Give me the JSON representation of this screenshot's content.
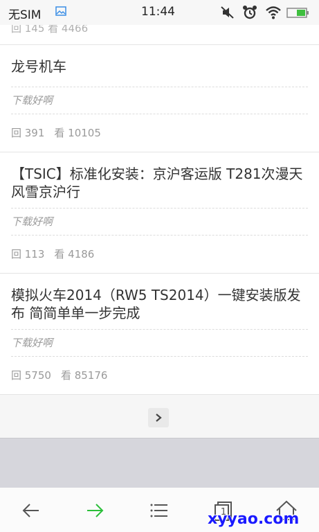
{
  "status_bar": {
    "carrier": "无SIM",
    "time": "11:44",
    "icons": [
      "image-icon",
      "mute-icon",
      "alarm-icon",
      "wifi-icon",
      "battery-icon"
    ]
  },
  "previous_item_meta": "回 145  看 4466",
  "items": [
    {
      "title": "龙号机车",
      "quote": "下载好啊",
      "replies": "回 391",
      "views": "看 10105"
    },
    {
      "title": "【TSIC】标准化安装：京沪客运版 T281次漫天风雪京沪行",
      "quote": "下载好啊",
      "replies": "回 113",
      "views": "看 4186"
    },
    {
      "title": "模拟火车2014（RW5 TS2014）一键安装版发布 简简单单一步完成",
      "quote": "下载好啊",
      "replies": "回 5750",
      "views": "看 85176"
    }
  ],
  "pager": {
    "next_icon": "chevron-right-icon"
  },
  "nav_bar": {
    "icons": [
      "back-arrow-icon",
      "forward-arrow-icon",
      "menu-icon",
      "tabs-icon",
      "home-icon"
    ],
    "tabs_count": "1",
    "forward_color": "#2bbf3a"
  },
  "watermark": "xyyao.com"
}
